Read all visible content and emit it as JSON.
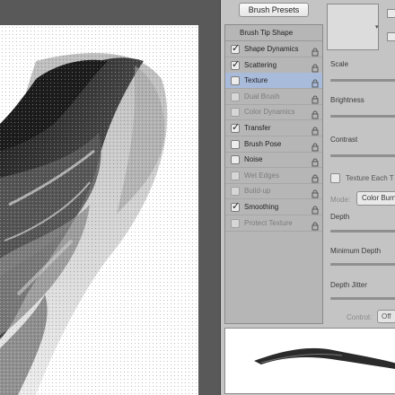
{
  "panel": {
    "presets_button": "Brush Presets",
    "tip_shape": "Brush Tip Shape",
    "options": [
      {
        "label": "Shape Dynamics",
        "checked": true,
        "enabled": true,
        "selected": false
      },
      {
        "label": "Scattering",
        "checked": true,
        "enabled": true,
        "selected": false
      },
      {
        "label": "Texture",
        "checked": false,
        "enabled": true,
        "selected": true
      },
      {
        "label": "Dual Brush",
        "checked": false,
        "enabled": false,
        "selected": false
      },
      {
        "label": "Color Dynamics",
        "checked": false,
        "enabled": false,
        "selected": false
      },
      {
        "label": "Transfer",
        "checked": true,
        "enabled": true,
        "selected": false
      },
      {
        "label": "Brush Pose",
        "checked": false,
        "enabled": true,
        "selected": false
      },
      {
        "label": "Noise",
        "checked": false,
        "enabled": true,
        "selected": false
      },
      {
        "label": "Wet Edges",
        "checked": false,
        "enabled": false,
        "selected": false
      },
      {
        "label": "Build-up",
        "checked": false,
        "enabled": false,
        "selected": false
      },
      {
        "label": "Smoothing",
        "checked": true,
        "enabled": true,
        "selected": false
      },
      {
        "label": "Protect Texture",
        "checked": false,
        "enabled": false,
        "selected": false
      }
    ]
  },
  "texture": {
    "scale": "Scale",
    "brightness": "Brightness",
    "contrast": "Contrast",
    "texture_each_tip": "Texture Each T",
    "mode_label": "Mode:",
    "mode_value": "Color Burn",
    "depth": "Depth",
    "minimum_depth": "Minimum Depth",
    "depth_jitter": "Depth Jitter",
    "control_label": "Control:",
    "control_value": "Off"
  },
  "colors": {
    "panel_bg": "#c4c4c4",
    "selection": "#a9bbdb",
    "canvas": "#ffffff"
  }
}
